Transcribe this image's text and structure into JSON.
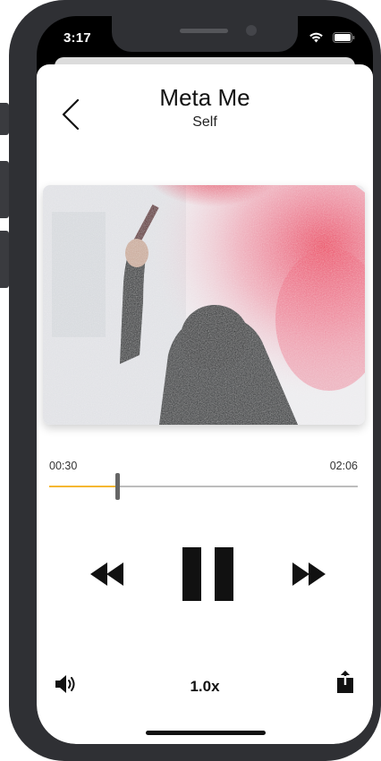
{
  "status_bar": {
    "time": "3:17",
    "icons": [
      "wifi-icon",
      "battery-icon"
    ]
  },
  "header": {
    "back_icon": "chevron-left-icon",
    "title": "Meta Me",
    "subtitle": "Self"
  },
  "artwork": {
    "description_icon": "album-art"
  },
  "player": {
    "elapsed": "00:30",
    "duration": "02:06",
    "progress_fraction": 0.22,
    "accent_color": "#f5b731",
    "track_color": "#bdbdbd"
  },
  "controls": {
    "rewind_icon": "rewind-icon",
    "pause_icon": "pause-icon",
    "forward_icon": "fast-forward-icon",
    "volume_icon": "volume-icon",
    "speed_label": "1.0x",
    "share_icon": "share-icon"
  }
}
